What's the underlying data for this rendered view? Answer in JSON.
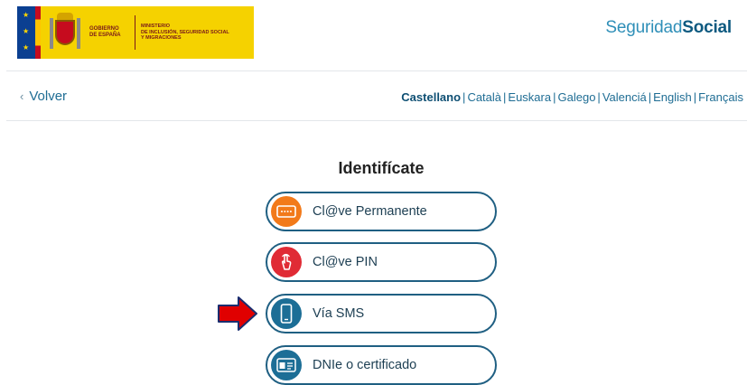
{
  "header": {
    "gov_line1": "GOBIERNO",
    "gov_line2": "DE ESPAÑA",
    "ministry_line1": "MINISTERIO",
    "ministry_line2": "DE INCLUSIÓN, SEGURIDAD SOCIAL",
    "ministry_line3": "Y MIGRACIONES",
    "brand_part1": "Seguridad",
    "brand_part2": "Social"
  },
  "nav": {
    "back_label": "Volver",
    "languages": [
      "Castellano",
      "Català",
      "Euskara",
      "Galego",
      "Valenciá",
      "English",
      "Français"
    ],
    "active_language": "Castellano"
  },
  "main": {
    "title": "Identifícate",
    "options": [
      {
        "label": "Cl@ve Permanente",
        "icon": "keyboard-icon",
        "color": "#f27a1a"
      },
      {
        "label": "Cl@ve PIN",
        "icon": "hand-tap-icon",
        "color": "#e02b35"
      },
      {
        "label": "Vía SMS",
        "icon": "mobile-phone-icon",
        "color": "#1c6e96"
      },
      {
        "label": "DNIe o certificado",
        "icon": "id-card-icon",
        "color": "#1c6e96"
      }
    ],
    "highlighted_option": "Vía SMS"
  },
  "colors": {
    "accent": "#1f5f82",
    "link": "#1f6d94",
    "annotation_arrow": "#e00000"
  }
}
